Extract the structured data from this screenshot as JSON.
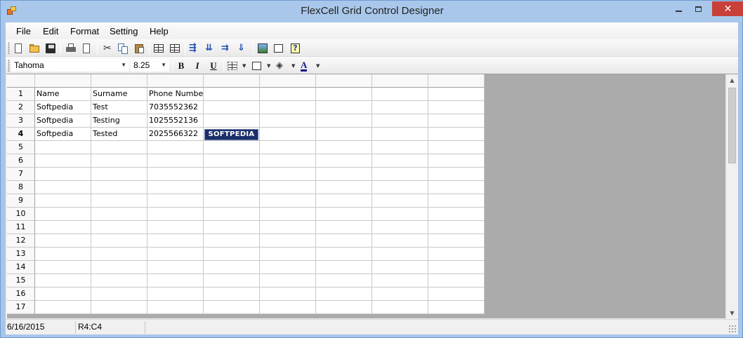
{
  "window": {
    "title": "FlexCell Grid Control Designer"
  },
  "menu": [
    "File",
    "Edit",
    "Format",
    "Setting",
    "Help"
  ],
  "toolbar": {
    "icons": [
      "new-document-icon",
      "open-folder-icon",
      "save-disk-icon",
      "print-icon",
      "print-preview-icon",
      "cut-icon",
      "copy-icon",
      "paste-icon",
      "insert-row-icon",
      "delete-row-icon",
      "insert-col-icon",
      "split-icon",
      "merge-icon",
      "filter-icon",
      "image-icon",
      "properties-icon",
      "help-icon"
    ]
  },
  "format_toolbar": {
    "font_name": "Tahoma",
    "font_size": "8.25",
    "bold_label": "B",
    "italic_label": "I",
    "underline_label": "U"
  },
  "grid": {
    "column_count": 8,
    "rows": [
      {
        "num": "1",
        "cells": [
          "Name",
          "Surname",
          "Phone Number",
          "",
          "",
          "",
          "",
          ""
        ]
      },
      {
        "num": "2",
        "cells": [
          "Softpedia",
          "Test",
          "7035552362",
          "",
          "",
          "",
          "",
          ""
        ]
      },
      {
        "num": "3",
        "cells": [
          "Softpedia",
          "Testing",
          "1025552136",
          "",
          "",
          "",
          "",
          ""
        ]
      },
      {
        "num": "4",
        "cells": [
          "Softpedia",
          "Tested",
          "2025566322",
          "SOFTPEDIA",
          "",
          "",
          "",
          ""
        ]
      },
      {
        "num": "5",
        "cells": [
          "",
          "",
          "",
          "",
          "",
          "",
          "",
          ""
        ]
      },
      {
        "num": "6",
        "cells": [
          "",
          "",
          "",
          "",
          "",
          "",
          "",
          ""
        ]
      },
      {
        "num": "7",
        "cells": [
          "",
          "",
          "",
          "",
          "",
          "",
          "",
          ""
        ]
      },
      {
        "num": "8",
        "cells": [
          "",
          "",
          "",
          "",
          "",
          "",
          "",
          ""
        ]
      },
      {
        "num": "9",
        "cells": [
          "",
          "",
          "",
          "",
          "",
          "",
          "",
          ""
        ]
      },
      {
        "num": "10",
        "cells": [
          "",
          "",
          "",
          "",
          "",
          "",
          "",
          ""
        ]
      },
      {
        "num": "11",
        "cells": [
          "",
          "",
          "",
          "",
          "",
          "",
          "",
          ""
        ]
      },
      {
        "num": "12",
        "cells": [
          "",
          "",
          "",
          "",
          "",
          "",
          "",
          ""
        ]
      },
      {
        "num": "13",
        "cells": [
          "",
          "",
          "",
          "",
          "",
          "",
          "",
          ""
        ]
      },
      {
        "num": "14",
        "cells": [
          "",
          "",
          "",
          "",
          "",
          "",
          "",
          ""
        ]
      },
      {
        "num": "15",
        "cells": [
          "",
          "",
          "",
          "",
          "",
          "",
          "",
          ""
        ]
      },
      {
        "num": "16",
        "cells": [
          "",
          "",
          "",
          "",
          "",
          "",
          "",
          ""
        ]
      },
      {
        "num": "17",
        "cells": [
          "",
          "",
          "",
          "",
          "",
          "",
          "",
          ""
        ]
      }
    ],
    "active_row": "4",
    "logo_text": "SOFTPEDIA"
  },
  "status": {
    "date": "6/16/2015",
    "cell_ref": "R4:C4"
  },
  "colors": {
    "title_bar": "#a9c7ea",
    "close_button": "#c7403a",
    "grid_background": "#ababab",
    "logo_background": "#1b2f6b"
  }
}
